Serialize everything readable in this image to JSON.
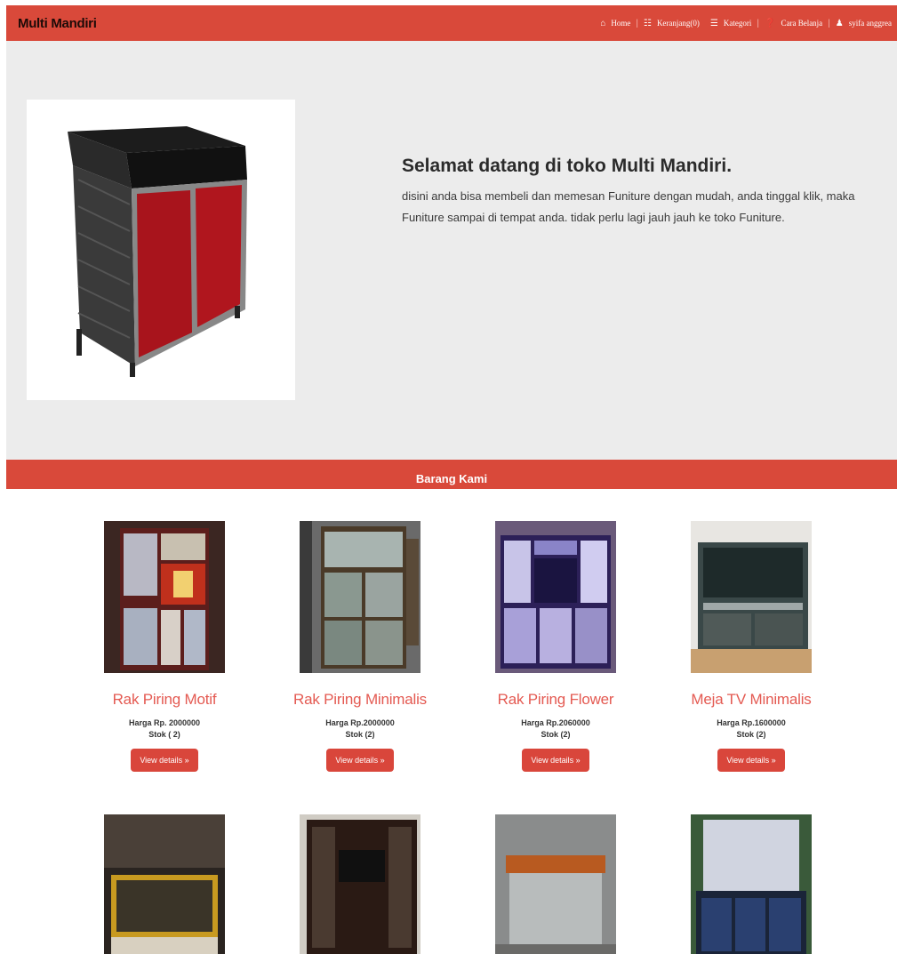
{
  "navbar": {
    "brand": "Multi Mandiri",
    "items": [
      {
        "label": "Home",
        "icon": "home-icon"
      },
      {
        "label": "Keranjang(0)",
        "icon": "cart-icon"
      },
      {
        "label": "Kategori",
        "icon": "list-icon"
      },
      {
        "label": "Cara Belanja",
        "icon": "help-icon"
      },
      {
        "label": "syifa anggrea",
        "icon": "user-icon"
      }
    ]
  },
  "hero": {
    "title": "Selamat datang di toko Multi Mandiri.",
    "text": "disini anda bisa membeli dan memesan Funiture dengan mudah, anda tinggal klik, maka Funiture sampai di tempat anda. tidak perlu lagi jauh jauh ke toko Funiture."
  },
  "section": {
    "title": "Barang Kami"
  },
  "products": [
    {
      "name": "Rak Piring Motif",
      "price": "Harga Rp. 2000000",
      "stock": "Stok ( 2)",
      "button": "View details »"
    },
    {
      "name": "Rak Piring Minimalis",
      "price": "Harga Rp.2000000",
      "stock": "Stok (2)",
      "button": "View details »"
    },
    {
      "name": "Rak Piring Flower",
      "price": "Harga Rp.2060000",
      "stock": "Stok (2)",
      "button": "View details »"
    },
    {
      "name": "Meja TV Minimalis",
      "price": "Harga Rp.1600000",
      "stock": "Stok (2)",
      "button": "View details »"
    }
  ],
  "colors": {
    "accent": "#d9493a",
    "hero_bg": "#ececec",
    "product_name": "#e45a52"
  }
}
